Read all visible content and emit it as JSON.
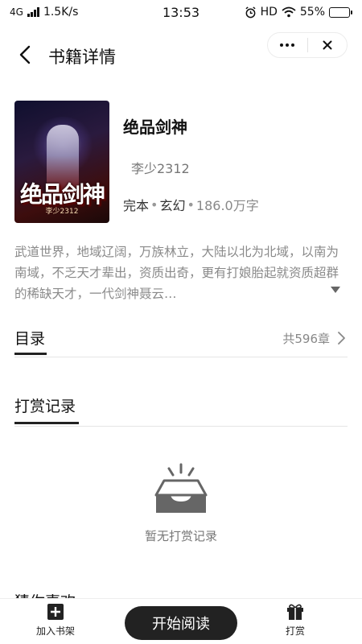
{
  "status_bar": {
    "network": "4G",
    "speed": "1.5K/s",
    "time": "13:53",
    "hd": "HD",
    "battery": "55%",
    "battery_level": 0.55
  },
  "header": {
    "title": "书籍详情"
  },
  "book": {
    "cover_title": "绝品剑神",
    "cover_author": "李少2312",
    "title": "绝品剑神",
    "author": "李少2312",
    "status": "完本",
    "genre": "玄幻",
    "separator": "•",
    "word_count": "186.0万字",
    "description": "武道世界，地域辽阔，万族林立，大陆以北为北域，以南为南域，不乏天才辈出，资质出奇，更有打娘胎起就资质超群的稀缺天才，一代剑神聂云…"
  },
  "toc": {
    "label": "目录",
    "count": "共596章"
  },
  "rewards": {
    "label": "打赏记录",
    "empty_text": "暂无打赏记录"
  },
  "recommend": {
    "label": "猜你喜欢"
  },
  "bottom_bar": {
    "add_shelf": "加入书架",
    "read": "开始阅读",
    "reward": "打赏"
  },
  "icons": [
    "back-icon",
    "more-icon",
    "close-icon",
    "chevron-right-icon",
    "expand-icon",
    "empty-inbox-icon",
    "add-icon",
    "gift-icon",
    "wifi-icon",
    "alarm-icon",
    "signal-icon",
    "battery-icon"
  ]
}
